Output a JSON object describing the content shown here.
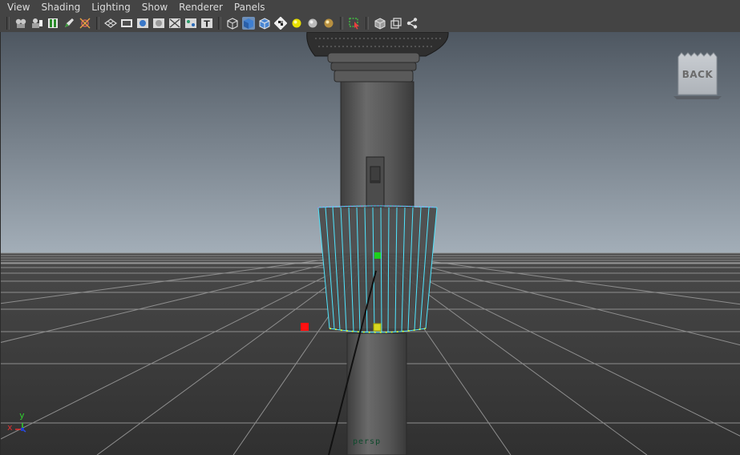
{
  "menubar": {
    "items": [
      "View",
      "Shading",
      "Lighting",
      "Show",
      "Renderer",
      "Panels"
    ]
  },
  "toolbar": {
    "groups": [
      [
        "camera-attributes-icon",
        "bookmark-camera-icon",
        "image-plane-icon",
        "grease-pencil-icon",
        "frame-icon"
      ],
      [
        "grid-toggle-icon",
        "film-gate-icon",
        "resolution-gate-icon",
        "gate-mask-icon",
        "field-chart-icon",
        "safe-action-icon",
        "safe-title-icon"
      ],
      [
        "wireframe-icon",
        "smooth-shade-icon",
        "wireframe-on-shaded-icon",
        "texture-icon",
        "lighting-icon",
        "shadows-icon",
        "high-quality-icon"
      ],
      [
        "isolate-select-icon"
      ],
      [
        "xray-icon",
        "xray-joints-icon",
        "xray-components-icon"
      ]
    ]
  },
  "viewport": {
    "camera_label": "persp",
    "back_label": "BACK",
    "axis": {
      "x": "x",
      "y": "y"
    }
  },
  "colors": {
    "sky_top": "#4e5761",
    "sky_bottom": "#a3aeb8",
    "floor": "#373737",
    "selection_wire": "#4fe6ff",
    "vertex": "#e0ff30",
    "handle_red": "#ff1010",
    "handle_green": "#1cd01c",
    "cylinder": "#545454"
  }
}
